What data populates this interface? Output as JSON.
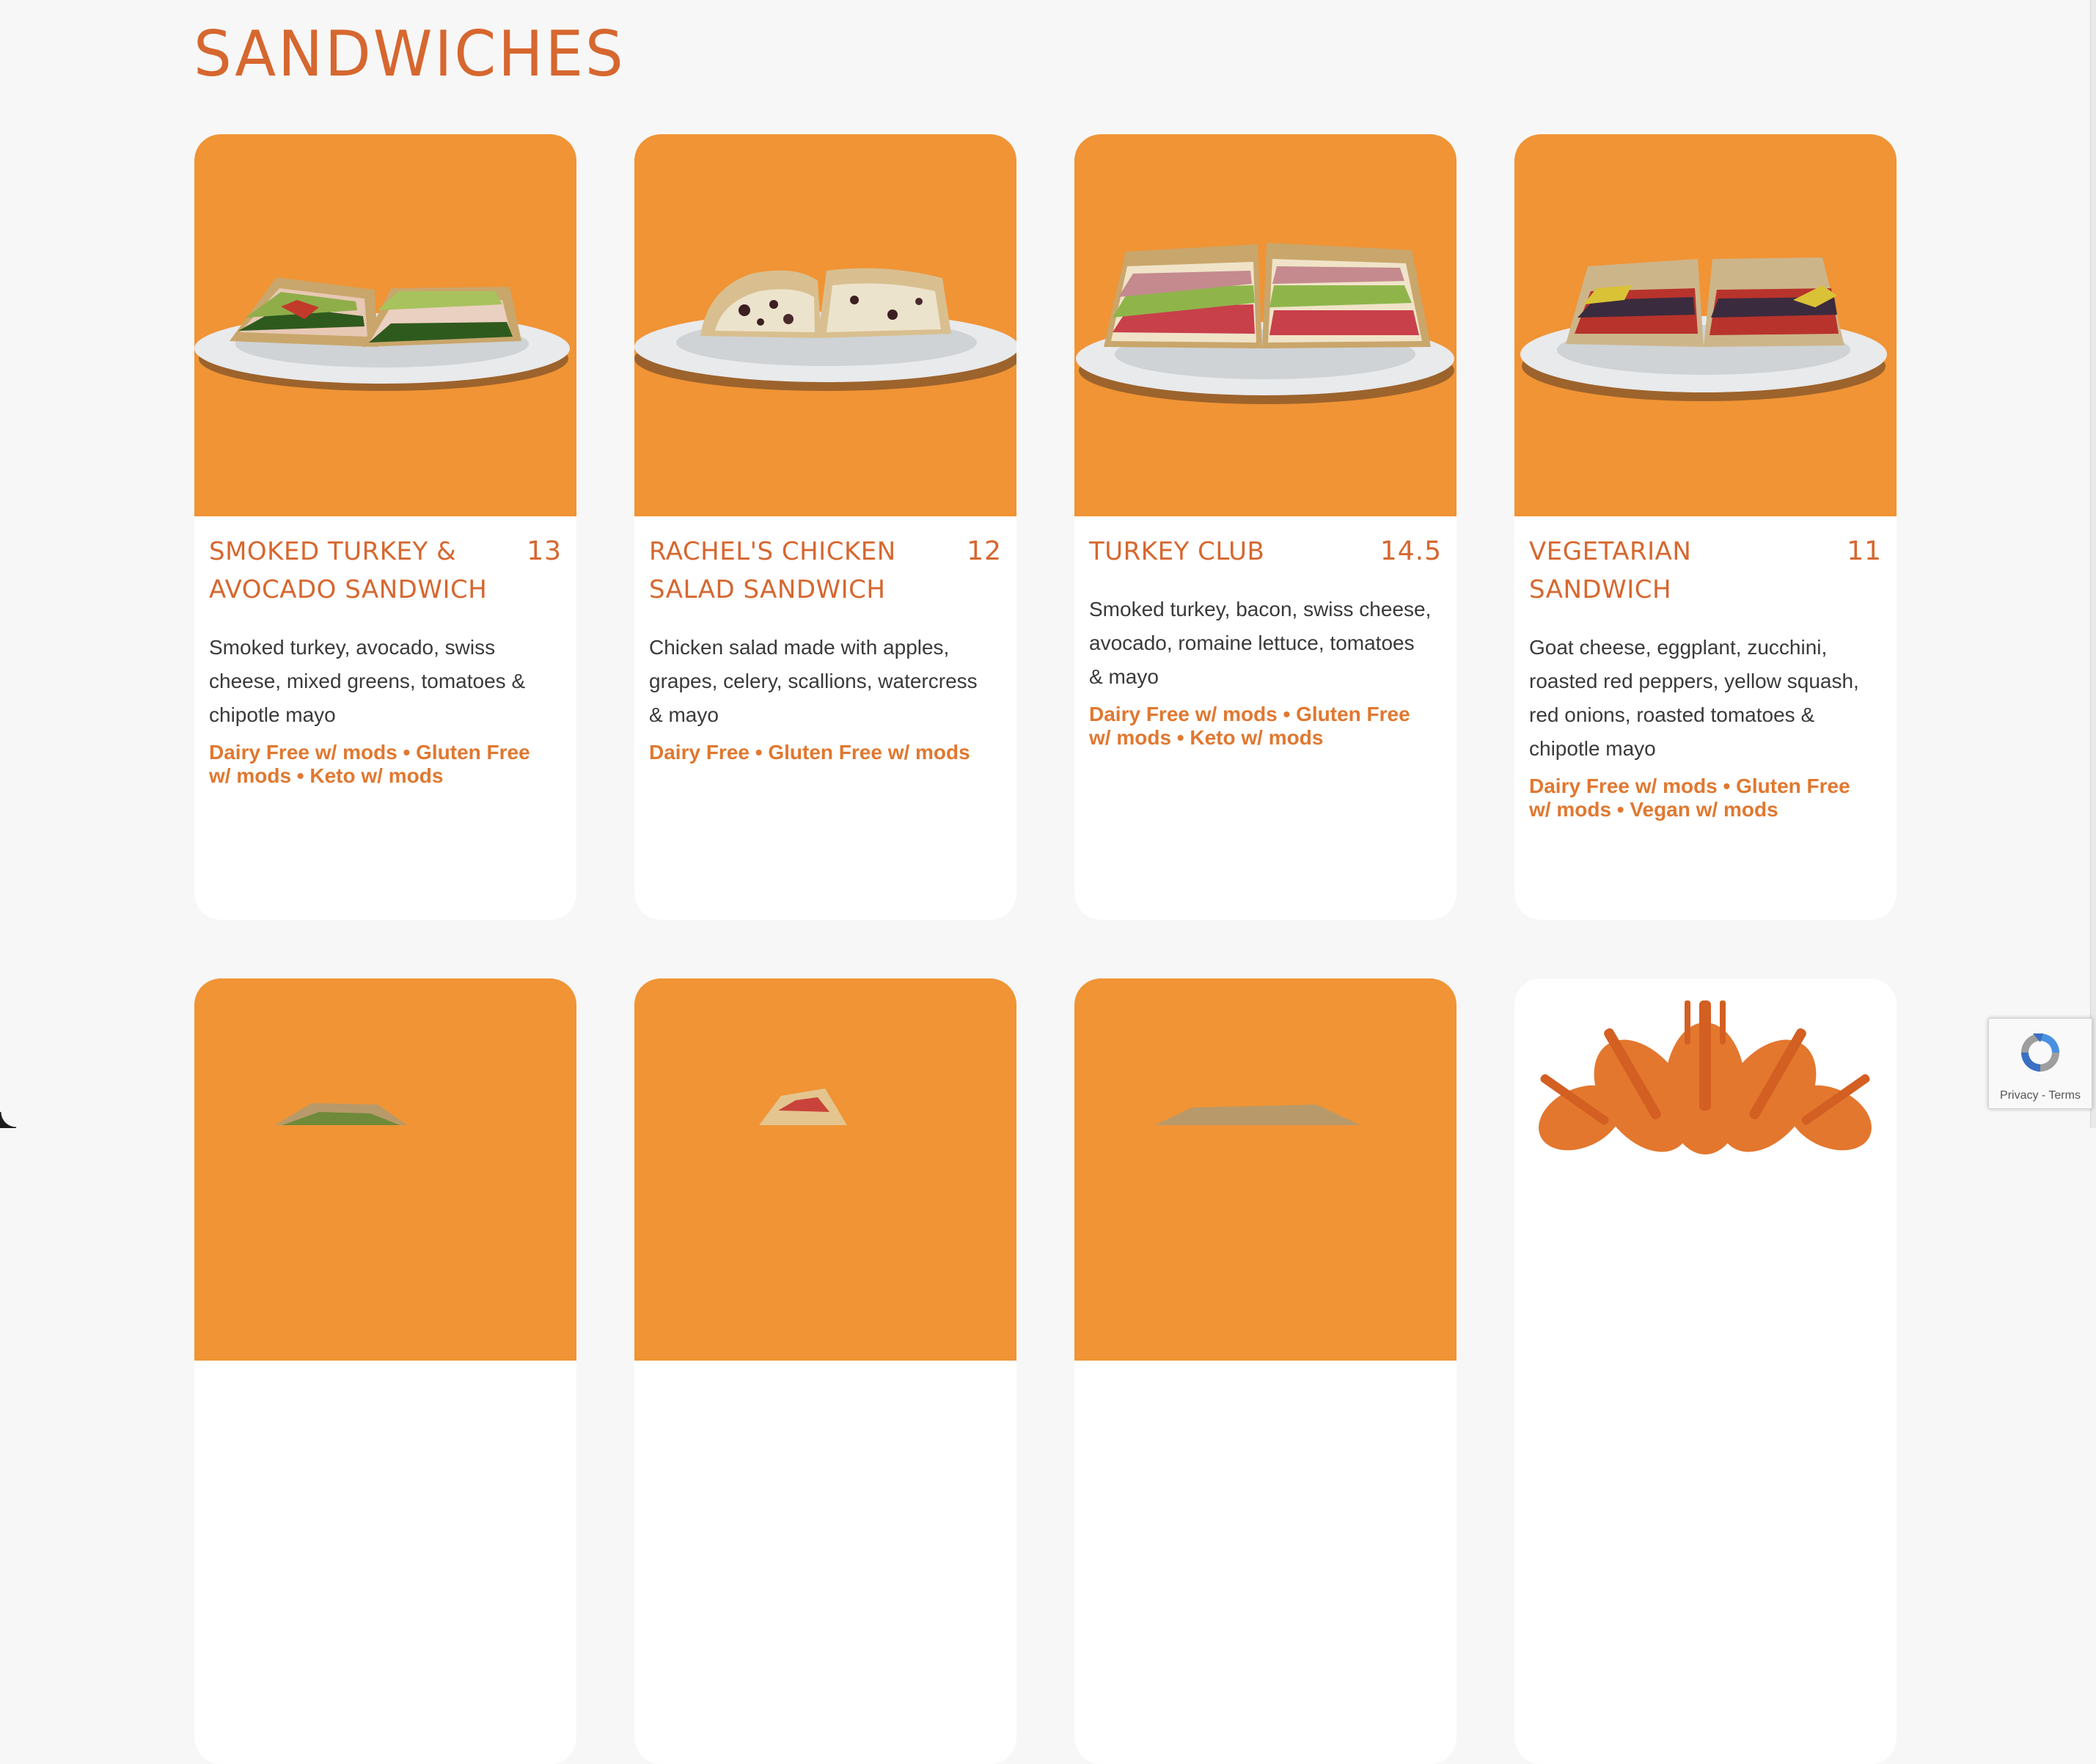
{
  "section": {
    "title": "SANDWICHES"
  },
  "colors": {
    "accent": "#d6672f",
    "tile_orange": "#f09435",
    "tag_orange": "#e07830",
    "page_bg": "#f7f7f7"
  },
  "items": [
    {
      "name": "SMOKED TURKEY & AVOCADO SANDWICH",
      "price": "13",
      "description": "Smoked turkey, avocado, swiss cheese, mixed greens, tomatoes & chipotle mayo",
      "tags": "Dairy Free w/ mods • Gluten Free w/ mods • Keto w/ mods"
    },
    {
      "name": "RACHEL'S CHICKEN SALAD SANDWICH",
      "price": "12",
      "description": "Chicken salad made with apples, grapes, celery, scallions, watercress & mayo",
      "tags": "Dairy Free • Gluten Free w/ mods"
    },
    {
      "name": "TURKEY CLUB",
      "price": "14.5",
      "description": "Smoked turkey, bacon, swiss cheese, avocado, romaine lettuce, tomatoes & mayo",
      "tags": "Dairy Free w/ mods • Gluten Free w/ mods • Keto w/ mods"
    },
    {
      "name": "VEGETARIAN SANDWICH",
      "price": "11",
      "description": "Goat cheese, eggplant, zucchini, roasted red peppers, yellow squash, red onions, roasted tomatoes & chipotle mayo",
      "tags": "Dairy Free w/ mods • Gluten Free w/ mods • Vegan w/ mods"
    }
  ],
  "recaptcha": {
    "privacy": "Privacy",
    "separator": " - ",
    "terms": "Terms"
  }
}
